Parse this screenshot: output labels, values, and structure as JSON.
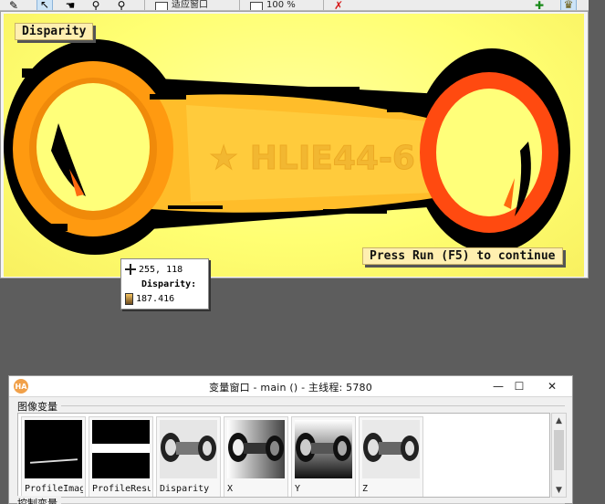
{
  "toolbar": {
    "fit_window_label": "适应窗口",
    "zoom_label": "100 %",
    "icons": [
      "pencil-icon",
      "pointer-icon",
      "hand-icon",
      "zoom-in-icon",
      "zoom-out-icon",
      "fit-window-icon",
      "zoom-icon",
      "clear-icon",
      "color-palette-icon",
      "trophy-icon"
    ]
  },
  "display": {
    "image_label": "Disparity",
    "continue_message": "Press Run (F5) to continue",
    "engraved_text": "★ HLIE44-6"
  },
  "pixel_info": {
    "coordinates": "255, 118",
    "channel_label": "Disparity:",
    "value": "187.416"
  },
  "variable_window": {
    "title": "变量窗口 - main () - 主线程: 5780",
    "logo_text": "HA",
    "minimize": "—",
    "maximize": "☐",
    "close": "✕",
    "image_vars_label": "图像变量",
    "control_vars_label": "控制变量",
    "scroll_up": "▲",
    "scroll_down": "▼",
    "thumbnails": [
      {
        "name": "ProfileImage"
      },
      {
        "name": "ProfileResult"
      },
      {
        "name": "Disparity"
      },
      {
        "name": "X"
      },
      {
        "name": "Y"
      },
      {
        "name": "Z"
      }
    ]
  },
  "colors": {
    "background_yellow": "#ffff72",
    "object_orange": "#ff9a10",
    "ring_red": "#ff4a10",
    "label_bg": "#ffefb0"
  }
}
